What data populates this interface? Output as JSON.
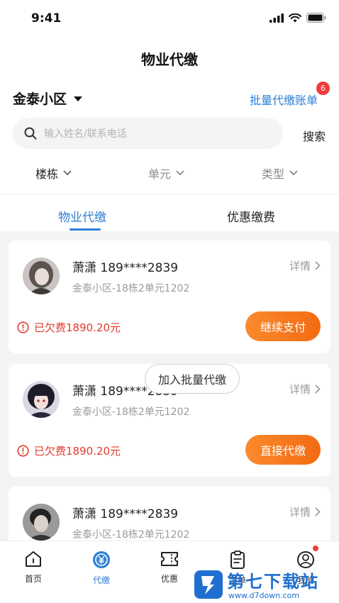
{
  "status_bar": {
    "time": "9:41"
  },
  "header": {
    "title": "物业代缴"
  },
  "community": {
    "name": "金泰小区",
    "batch_link": "批量代缴账单",
    "batch_count": "6"
  },
  "search": {
    "placeholder": "输入姓名/联系电话",
    "button": "搜索"
  },
  "filters": [
    {
      "label": "楼栋"
    },
    {
      "label": "单元"
    },
    {
      "label": "类型"
    }
  ],
  "tabs": [
    {
      "label": "物业代缴",
      "active": true
    },
    {
      "label": "优惠缴费",
      "active": false
    }
  ],
  "records": [
    {
      "name": "萧潇 189****2839",
      "address": "金泰小区-18栋2单元1202",
      "detail": "详情",
      "owed": "已欠费1890.20元",
      "primary_action": "继续支付"
    },
    {
      "name": "萧潇 189****2839",
      "address": "金泰小区-18栋2单元1202",
      "detail": "详情",
      "owed": "已欠费1890.20元",
      "secondary_action": "加入批量代缴",
      "primary_action": "直接代缴"
    },
    {
      "name": "萧潇 189****2839",
      "address": "金泰小区-18栋2单元1202",
      "detail": "详情"
    }
  ],
  "tabbar": [
    {
      "label": "首页",
      "icon": "home-icon"
    },
    {
      "label": "代缴",
      "icon": "pay-icon",
      "active": true
    },
    {
      "label": "优惠",
      "icon": "coupon-icon"
    },
    {
      "label": "工单",
      "icon": "clipboard-icon"
    },
    {
      "label": "我的",
      "icon": "profile-icon"
    }
  ],
  "watermark": {
    "text": "第七下载站",
    "url": "www.d7down.com"
  },
  "colors": {
    "accent": "#2f7fd6",
    "orange": "#f36b12",
    "alert": "#e23a2f"
  }
}
